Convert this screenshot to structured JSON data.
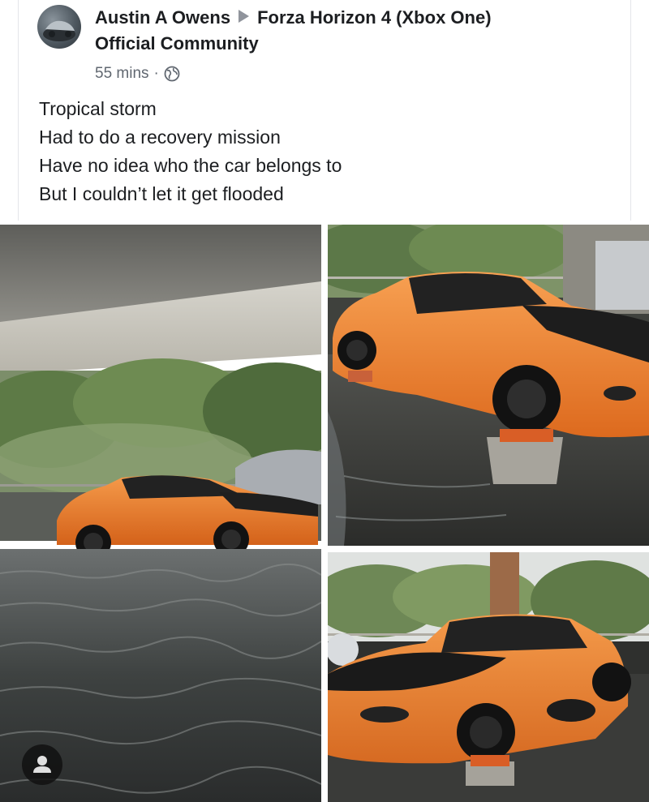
{
  "post": {
    "author": "Austin A Owens",
    "group": "Forza Horizon 4 (Xbox One)",
    "group_line2": "Official Community",
    "time": "55 mins",
    "separator": "·",
    "privacy_icon": "globe-icon",
    "lines": [
      "Tropical storm",
      "Had to do a recovery mission",
      "Have no idea who the car belongs to",
      "But I couldn’t let it get flooded"
    ]
  },
  "photos": [
    {
      "icon": "photo-flooded-garage"
    },
    {
      "icon": "photo-car-on-blocks-side"
    },
    {
      "icon": "photo-car-on-blocks-front"
    }
  ],
  "colors": {
    "car_orange": "#f07a24",
    "water": "#3b3f40",
    "text": "#1c1e21",
    "muted": "#606770"
  }
}
